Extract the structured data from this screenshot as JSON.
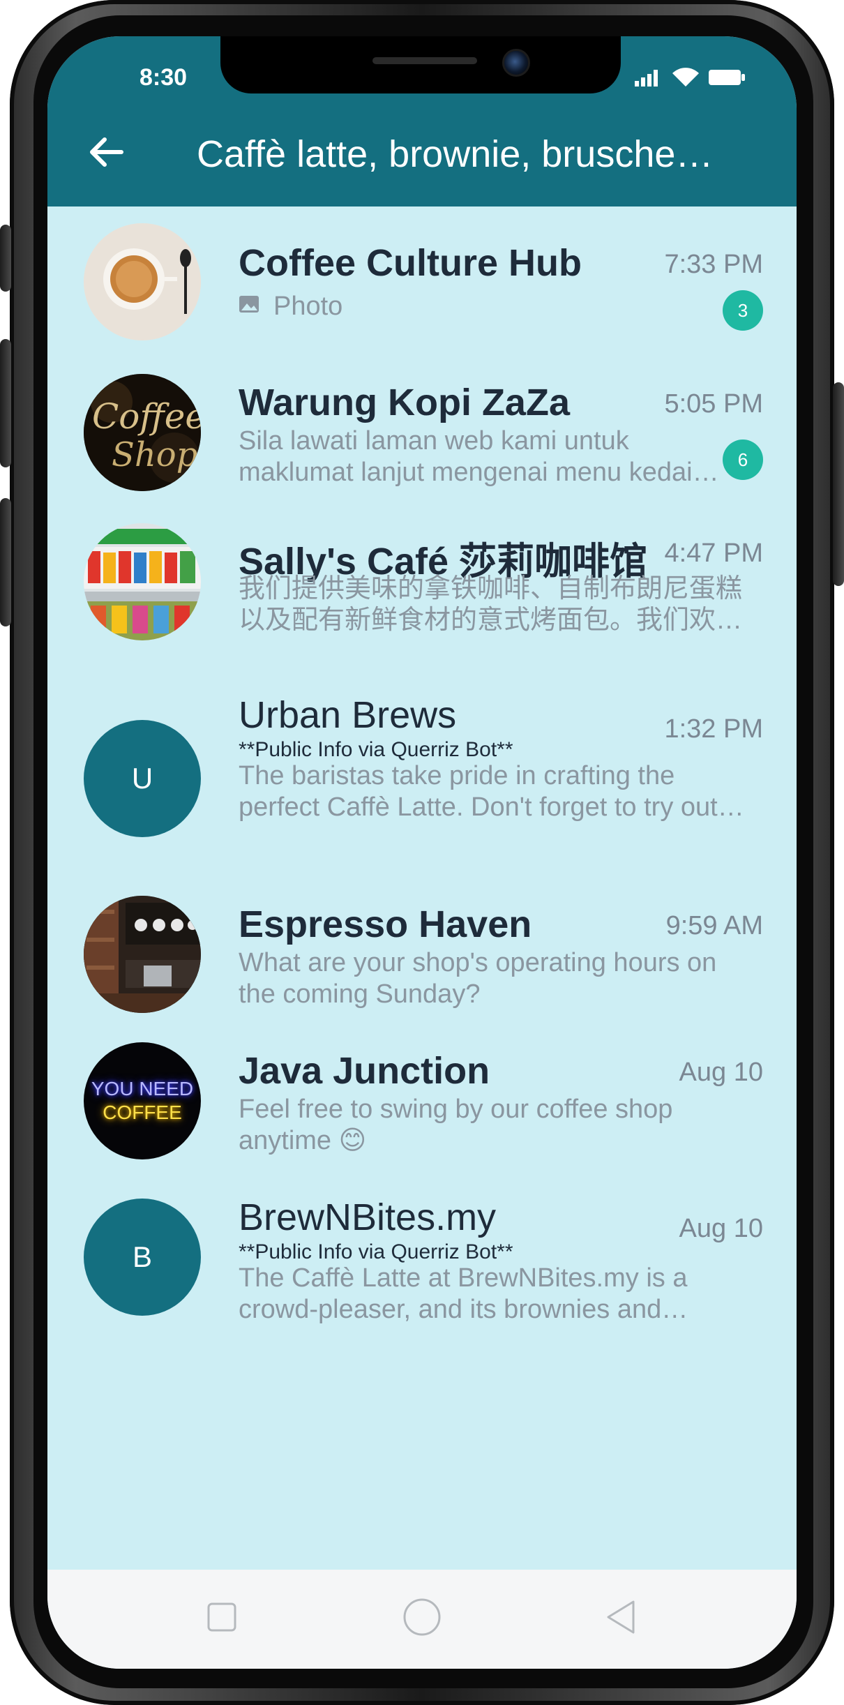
{
  "status_bar": {
    "time": "8:30",
    "icons": [
      "signal-icon",
      "wifi-icon",
      "battery-icon"
    ]
  },
  "app_bar": {
    "back_icon": "arrow-left-icon",
    "title": "Caffè latte, brownie, brusche…"
  },
  "colors": {
    "header": "#146f80",
    "list_background": "#cdeef4",
    "badge": "#1fb9a2",
    "avatar_letter_bg": "#146f80"
  },
  "chats": [
    {
      "name": "Coffee Culture Hub",
      "time": "7:33 PM",
      "preview_icon": "image-icon",
      "preview": "Photo",
      "unread": "3",
      "avatar": "latte-cup-photo"
    },
    {
      "name": "Warung Kopi ZaZa",
      "time": "5:05 PM",
      "preview": "Sila lawati laman web kami untuk maklumat lanjut mengenai menu kedai kami.",
      "unread": "6",
      "avatar": "coffee-shop-sign-photo"
    },
    {
      "name": "Sally's Café 莎莉咖啡馆",
      "time": "4:47 PM",
      "preview": "我们提供美味的拿铁咖啡、自制布朗尼蛋糕以及配有新鲜食材的意式烤面包。我们欢迎您光临！",
      "avatar": "shelf-products-photo"
    },
    {
      "name": "Urban Brews",
      "time": "1:32 PM",
      "note": "**Public Info via Querriz Bot**",
      "preview": "The baristas take pride in crafting the perfect Caffè Latte. Don't forget to try out their brownies.",
      "avatar_letter": "U"
    },
    {
      "name": "Espresso Haven",
      "time": "9:59 AM",
      "preview": "What are your shop's operating hours on the coming Sunday?",
      "avatar": "cafe-interior-photo"
    },
    {
      "name": "Java Junction",
      "time": "Aug 10",
      "preview": "Feel free to swing by our coffee shop anytime 😊",
      "avatar": "neon-sign-photo",
      "avatar_line1": "YOU NEED",
      "avatar_line2": "COFFEE"
    },
    {
      "name": "BrewNBites.my",
      "time": "Aug 10",
      "note": "**Public Info via Querriz Bot**",
      "preview": "The Caffè Latte at BrewNBites.my is a crowd-pleaser, and its brownies and bruschetta are also popular.",
      "avatar_letter": "B"
    }
  ],
  "nav_bar": {
    "icons": [
      "square-recents-icon",
      "circle-home-icon",
      "triangle-back-icon"
    ]
  }
}
